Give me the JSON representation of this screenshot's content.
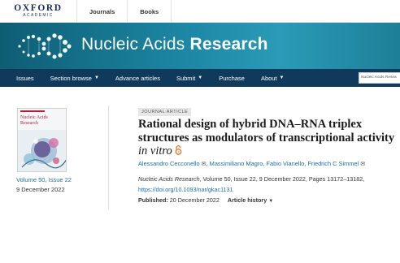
{
  "topbar": {
    "logo_line1": "OXFORD",
    "logo_line2": "ACADEMIC",
    "links": [
      "Journals",
      "Books"
    ]
  },
  "banner": {
    "title_light": "Nucleic Acids ",
    "title_bold": "Research"
  },
  "nav": {
    "items": [
      {
        "label": "Issues",
        "dropdown": false
      },
      {
        "label": "Section browse",
        "dropdown": true
      },
      {
        "label": "Advance articles",
        "dropdown": false
      },
      {
        "label": "Submit",
        "dropdown": true
      },
      {
        "label": "Purchase",
        "dropdown": false
      },
      {
        "label": "About",
        "dropdown": true
      }
    ],
    "search_value": "Nucleic Acids Resea"
  },
  "cover": {
    "title": "Nucleic Acids Research"
  },
  "issue": {
    "volume": "Volume 50, Issue 22",
    "date": "9 December 2022"
  },
  "article": {
    "type_badge": "JOURNAL ARTICLE",
    "title_main": "Rational design of hybrid DNA–RNA triplex structures as modulators of transcriptional activity ",
    "title_italic": "in vitro",
    "authors": [
      {
        "name": "Alessandro Cecconello",
        "email_icon": true
      },
      {
        "name": "Massimiliano Magro",
        "email_icon": false
      },
      {
        "name": "Fabio Vianello",
        "email_icon": false
      },
      {
        "name": "Friedrich C Simmel",
        "email_icon": true
      }
    ],
    "journal": "Nucleic Acids Research",
    "citation_rest": ", Volume 50, Issue 22, 9 December 2022, Pages 13172–13182,",
    "doi": "https://doi.org/10.1093/nar/gkac1131",
    "published_label": "Published:",
    "published_date": " 20 December 2022",
    "history_label": "Article history"
  },
  "icons": {
    "open_access": "open-access-icon",
    "email": "envelope-icon",
    "caret": "chevron-down-icon"
  },
  "colors": {
    "banner": "#1c86a3",
    "nav": "#0f3a5c",
    "link": "#1d6fa5",
    "open_access": "#e87722"
  }
}
